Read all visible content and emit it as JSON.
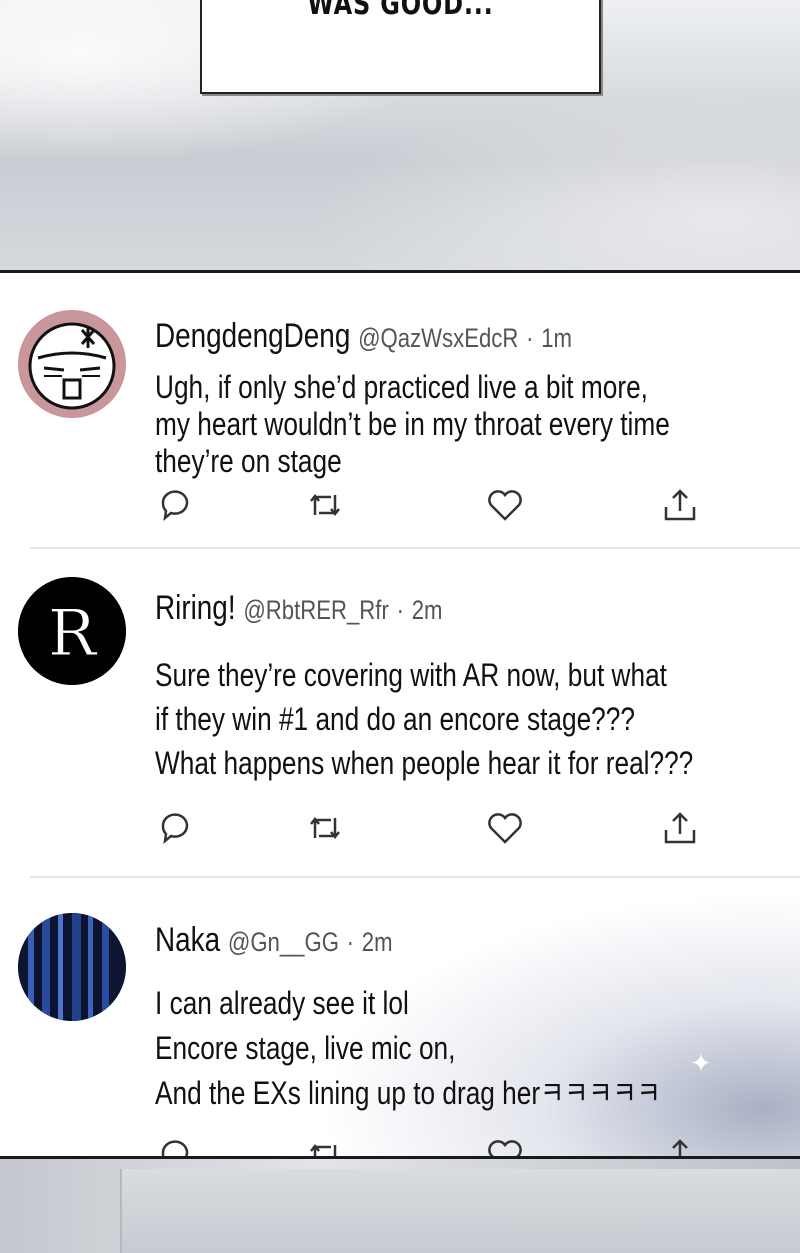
{
  "top": {
    "caption": "WAS GOOD..."
  },
  "tweets": [
    {
      "name": "DengdengDeng",
      "handle": "@QazWsxEdcR",
      "sep": "·",
      "time": "1m",
      "text": "Ugh, if only she’d practiced live a bit more,\nmy heart wouldn’t be in my throat every time\nthey’re on stage",
      "avatar_icon": "angry-bun-face-icon"
    },
    {
      "name": "Riring!",
      "handle": "@RbtRER_Rfr",
      "sep": "·",
      "time": "2m",
      "text": "Sure they’re covering with AR now, but what\nif they win #1 and do an encore stage???\nWhat happens when people hear it for real???",
      "avatar_letter": "R"
    },
    {
      "name": "Naka",
      "handle": "@Gn__GG",
      "sep": "·",
      "time": "2m",
      "text": "I can already see it lol\nEncore stage, live mic on,\nAnd the EXs lining up to drag herㅋㅋㅋㅋㅋ",
      "avatar_icon": "blue-bars-icon"
    }
  ],
  "actions": [
    "reply-icon",
    "retweet-icon",
    "like-icon",
    "share-icon"
  ],
  "colors": {
    "avatar1_ring": "#c9969c",
    "avatar2_bg": "#000000",
    "avatar3_bg": "#0d1430",
    "icon_stroke": "#333333"
  }
}
